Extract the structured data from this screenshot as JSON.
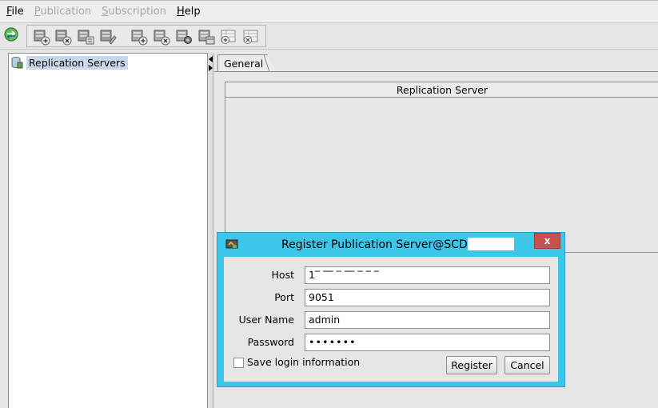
{
  "menu": {
    "items": [
      {
        "label": "File",
        "mnemonic": "F",
        "rest": "ile",
        "enabled": true
      },
      {
        "label": "Publication",
        "mnemonic": "P",
        "rest": "ublication",
        "enabled": false
      },
      {
        "label": "Subscription",
        "mnemonic": "S",
        "rest": "ubscription",
        "enabled": false
      },
      {
        "label": "Help",
        "mnemonic": "H",
        "rest": "elp",
        "enabled": true
      }
    ]
  },
  "toolbar": {
    "icons": [
      "refresh-icon",
      "add-publication-server-icon",
      "remove-publication-server-icon",
      "publication-properties-icon",
      "publication-sync-icon",
      "add-subscription-server-icon",
      "remove-subscription-server-icon",
      "subscription-settings-icon",
      "subscription-schedule-icon",
      "add-subscription-icon",
      "remove-subscription-icon"
    ]
  },
  "tree": {
    "root_label": "Replication Servers"
  },
  "tabs": {
    "general_label": "General"
  },
  "panel": {
    "header": "Replication Server"
  },
  "dialog": {
    "title": "Register Publication Server@SCD",
    "close_label": "x",
    "host_label": "Host",
    "host_value": "1‾ ‾‾ ‾ ‾‾ ‾ ‾ ‾",
    "port_label": "Port",
    "port_value": "9051",
    "user_label": "User Name",
    "user_value": "admin",
    "password_label": "Password",
    "password_value": "•••••••",
    "save_login_label": "Save login information",
    "save_login_checked": false,
    "register_label": "Register",
    "cancel_label": "Cancel"
  },
  "colors": {
    "dialog_frame": "#3cc6ea",
    "close_button": "#c75050",
    "tree_selection": "#c9d7ea"
  }
}
